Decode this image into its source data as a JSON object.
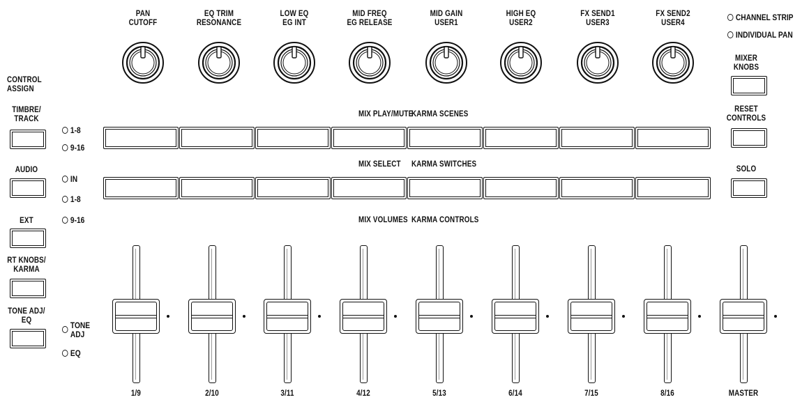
{
  "knob_labels": [
    [
      "PAN",
      "CUTOFF"
    ],
    [
      "EQ TRIM",
      "RESONANCE"
    ],
    [
      "LOW EQ",
      "EG INT"
    ],
    [
      "MID FREQ",
      "EG RELEASE"
    ],
    [
      "MID GAIN",
      "USER1"
    ],
    [
      "HIGH EQ",
      "USER2"
    ],
    [
      "FX SEND1",
      "USER3"
    ],
    [
      "FX SEND2",
      "USER4"
    ]
  ],
  "right_panel": {
    "led_channel_strip": "CHANNEL STRIP",
    "led_individual_pan": "INDIVIDUAL PAN",
    "mixer_knobs": [
      "MIXER",
      "KNOBS"
    ],
    "reset_controls": [
      "RESET",
      "CONTROLS"
    ],
    "solo": "SOLO"
  },
  "left_panel": {
    "control_assign": [
      "CONTROL",
      "ASSIGN"
    ],
    "timbre_track": [
      "TIMBRE/",
      "TRACK"
    ],
    "audio": "AUDIO",
    "ext": "EXT",
    "rt_knobs": [
      "RT KNOBS/",
      "KARMA"
    ],
    "tone_adj": [
      "TONE ADJ/",
      "EQ"
    ]
  },
  "leds": {
    "row1_a": "1-8",
    "row1_b": "9-16",
    "row2_in": "IN",
    "row2_a": "1-8",
    "row2_b": "9-16",
    "tone_adj": [
      "TONE",
      "ADJ"
    ],
    "eq": "EQ"
  },
  "section_labels": {
    "mix_play_mute": "MIX PLAY/MUTE",
    "karma_scenes": "KARMA SCENES",
    "mix_select": "MIX SELECT",
    "karma_switches": "KARMA SWITCHES",
    "mix_volumes": "MIX VOLUMES",
    "karma_controls": "KARMA CONTROLS"
  },
  "slider_labels": [
    "1/9",
    "2/10",
    "3/11",
    "4/12",
    "5/13",
    "6/14",
    "7/15",
    "8/16",
    "MASTER"
  ]
}
